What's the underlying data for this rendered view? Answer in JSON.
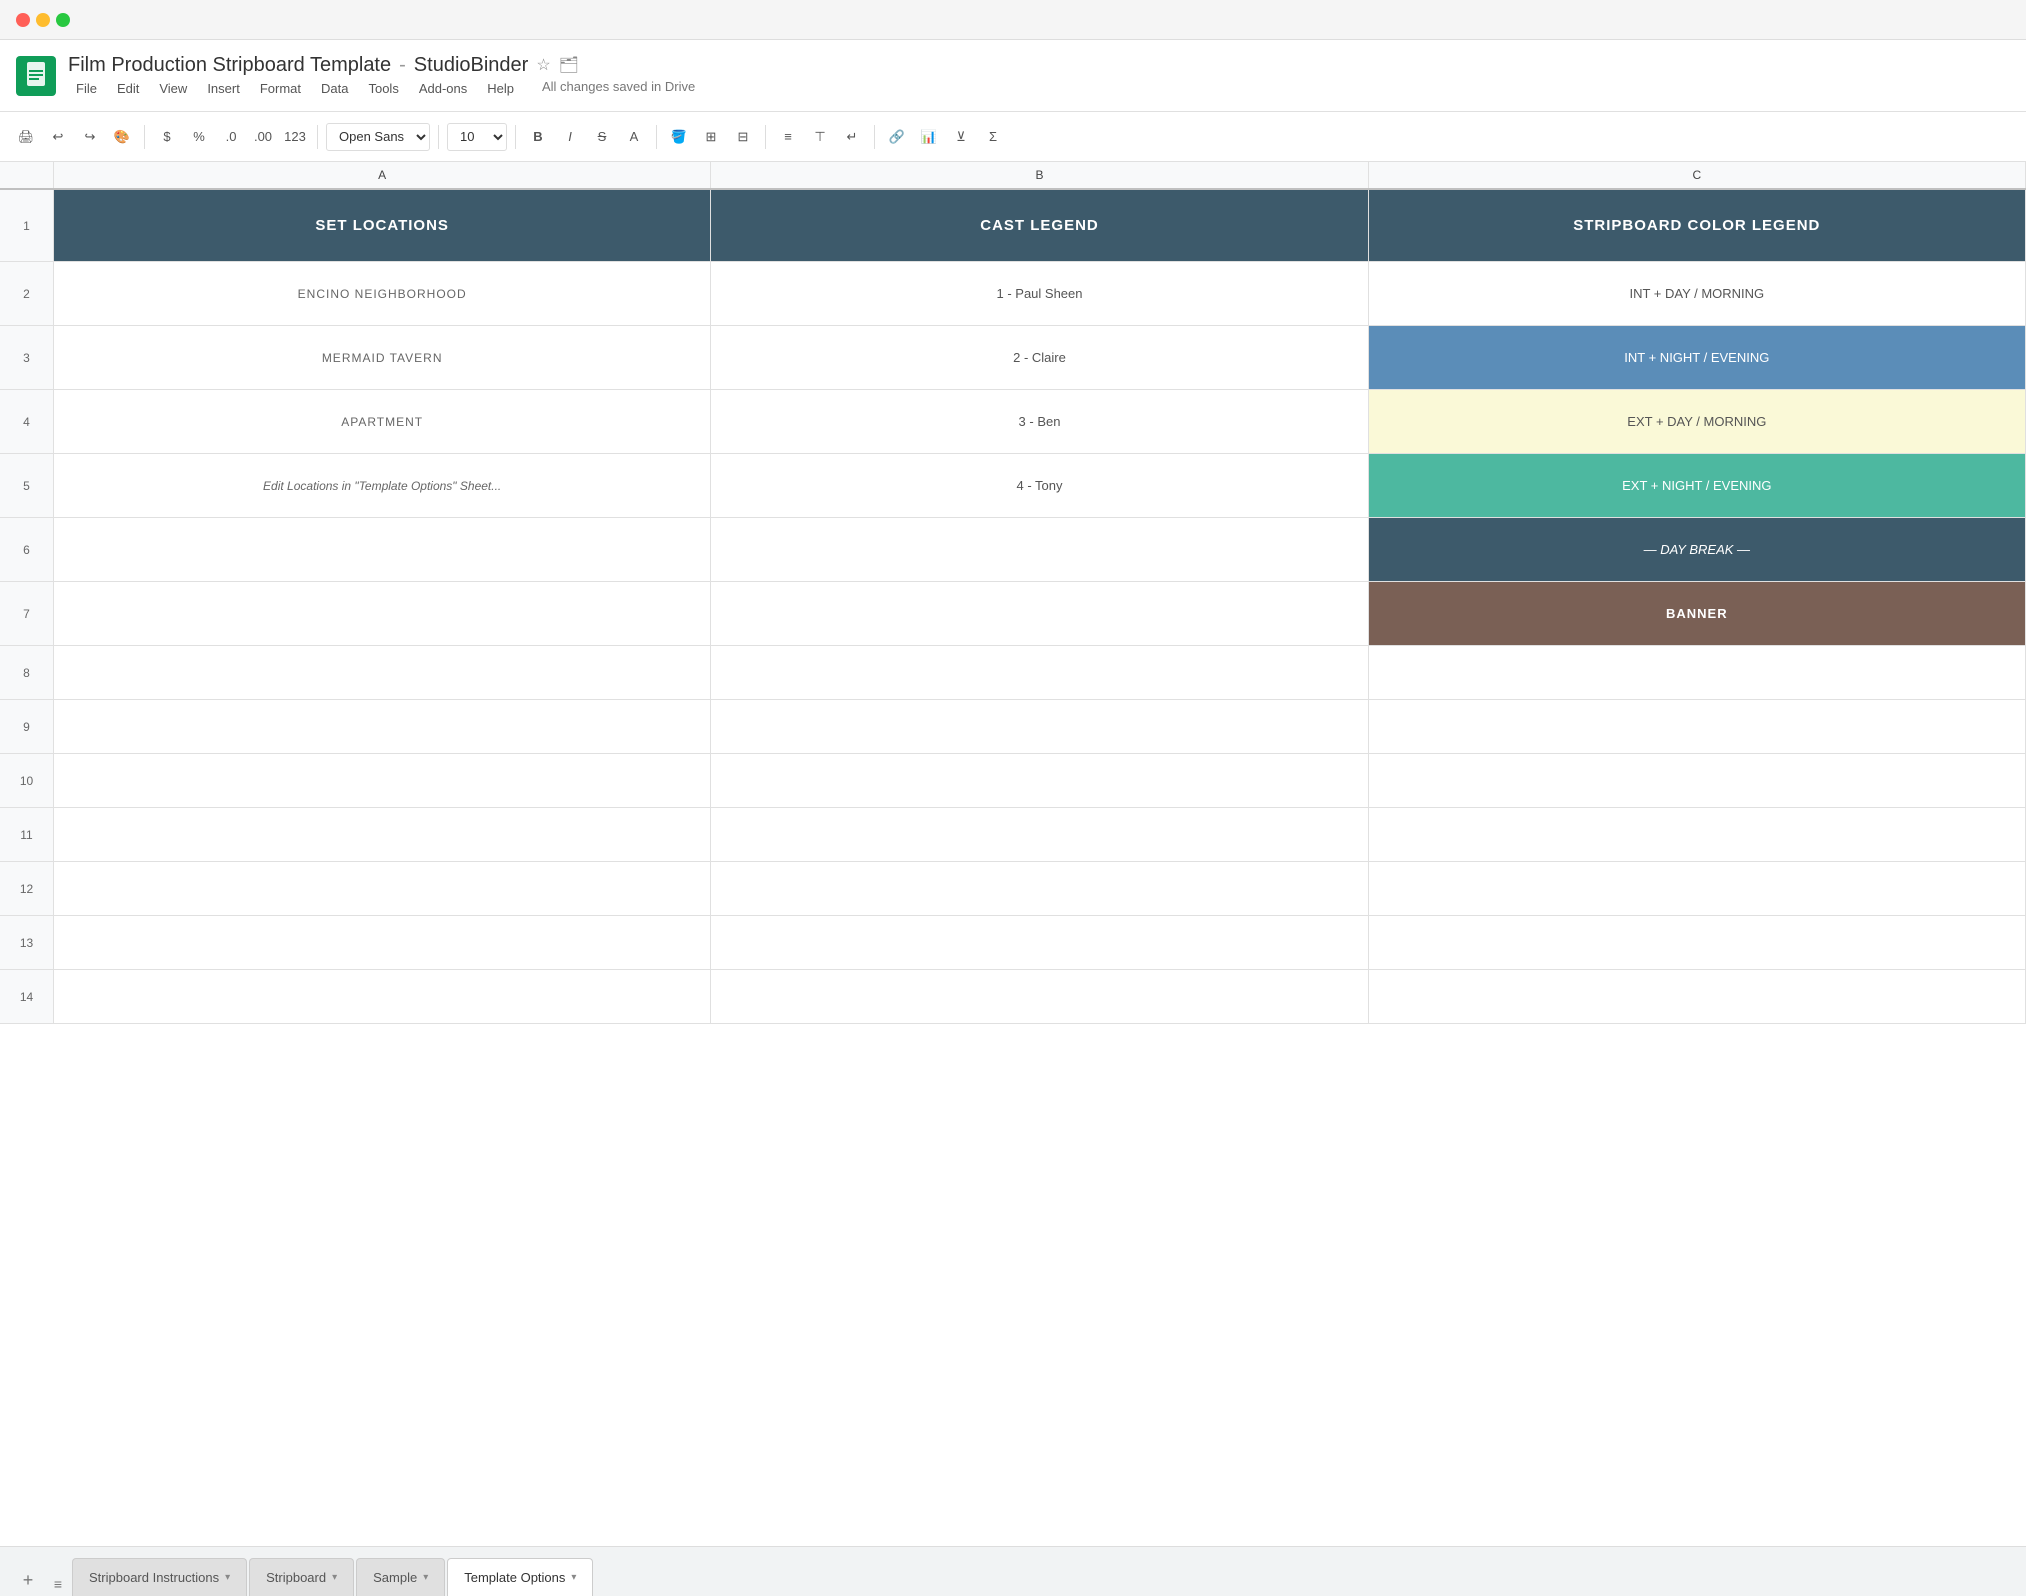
{
  "titleBar": {
    "windowControls": [
      "close",
      "minimize",
      "maximize"
    ]
  },
  "header": {
    "docTitle": "Film Production Stripboard Template",
    "separator": "-",
    "appName": "StudioBinder",
    "saveStatus": "All changes saved in Drive",
    "menuItems": [
      "File",
      "Edit",
      "View",
      "Insert",
      "Format",
      "Data",
      "Tools",
      "Add-ons",
      "Help"
    ]
  },
  "toolbar": {
    "fontFamily": "Open Sans",
    "fontSize": "10",
    "boldLabel": "B",
    "italicLabel": "I",
    "strikeLabel": "S"
  },
  "spreadsheet": {
    "columnHeaders": [
      "A",
      "B",
      "C"
    ],
    "rowNumbers": [
      1,
      2,
      3,
      4,
      5,
      6,
      7,
      8,
      9,
      10,
      11,
      12,
      13,
      14
    ],
    "row1": {
      "colA": "SET LOCATIONS",
      "colB": "CAST LEGEND",
      "colC": "STRIPBOARD COLOR LEGEND"
    },
    "row2": {
      "colA": "ENCINO NEIGHBORHOOD",
      "colB": "1 - Paul Sheen",
      "colC": "INT  +  DAY / MORNING"
    },
    "row3": {
      "colA": "MERMAID TAVERN",
      "colB": "2 - Claire",
      "colC": "INT  +  NIGHT / EVENING"
    },
    "row4": {
      "colA": "APARTMENT",
      "colB": "3 - Ben",
      "colC": "EXT  +  DAY / MORNING"
    },
    "row5": {
      "colA": "Edit Locations in \"Template Options\" Sheet...",
      "colB": "4 - Tony",
      "colC": "EXT  +  NIGHT / EVENING"
    },
    "row6": {
      "colA": "",
      "colB": "",
      "colC": "— DAY BREAK —"
    },
    "row7": {
      "colA": "",
      "colB": "",
      "colC": "BANNER"
    }
  },
  "tabs": [
    {
      "label": "Stripboard Instructions",
      "active": false
    },
    {
      "label": "Stripboard",
      "active": false
    },
    {
      "label": "Sample",
      "active": false
    },
    {
      "label": "Template Options",
      "active": true
    }
  ]
}
